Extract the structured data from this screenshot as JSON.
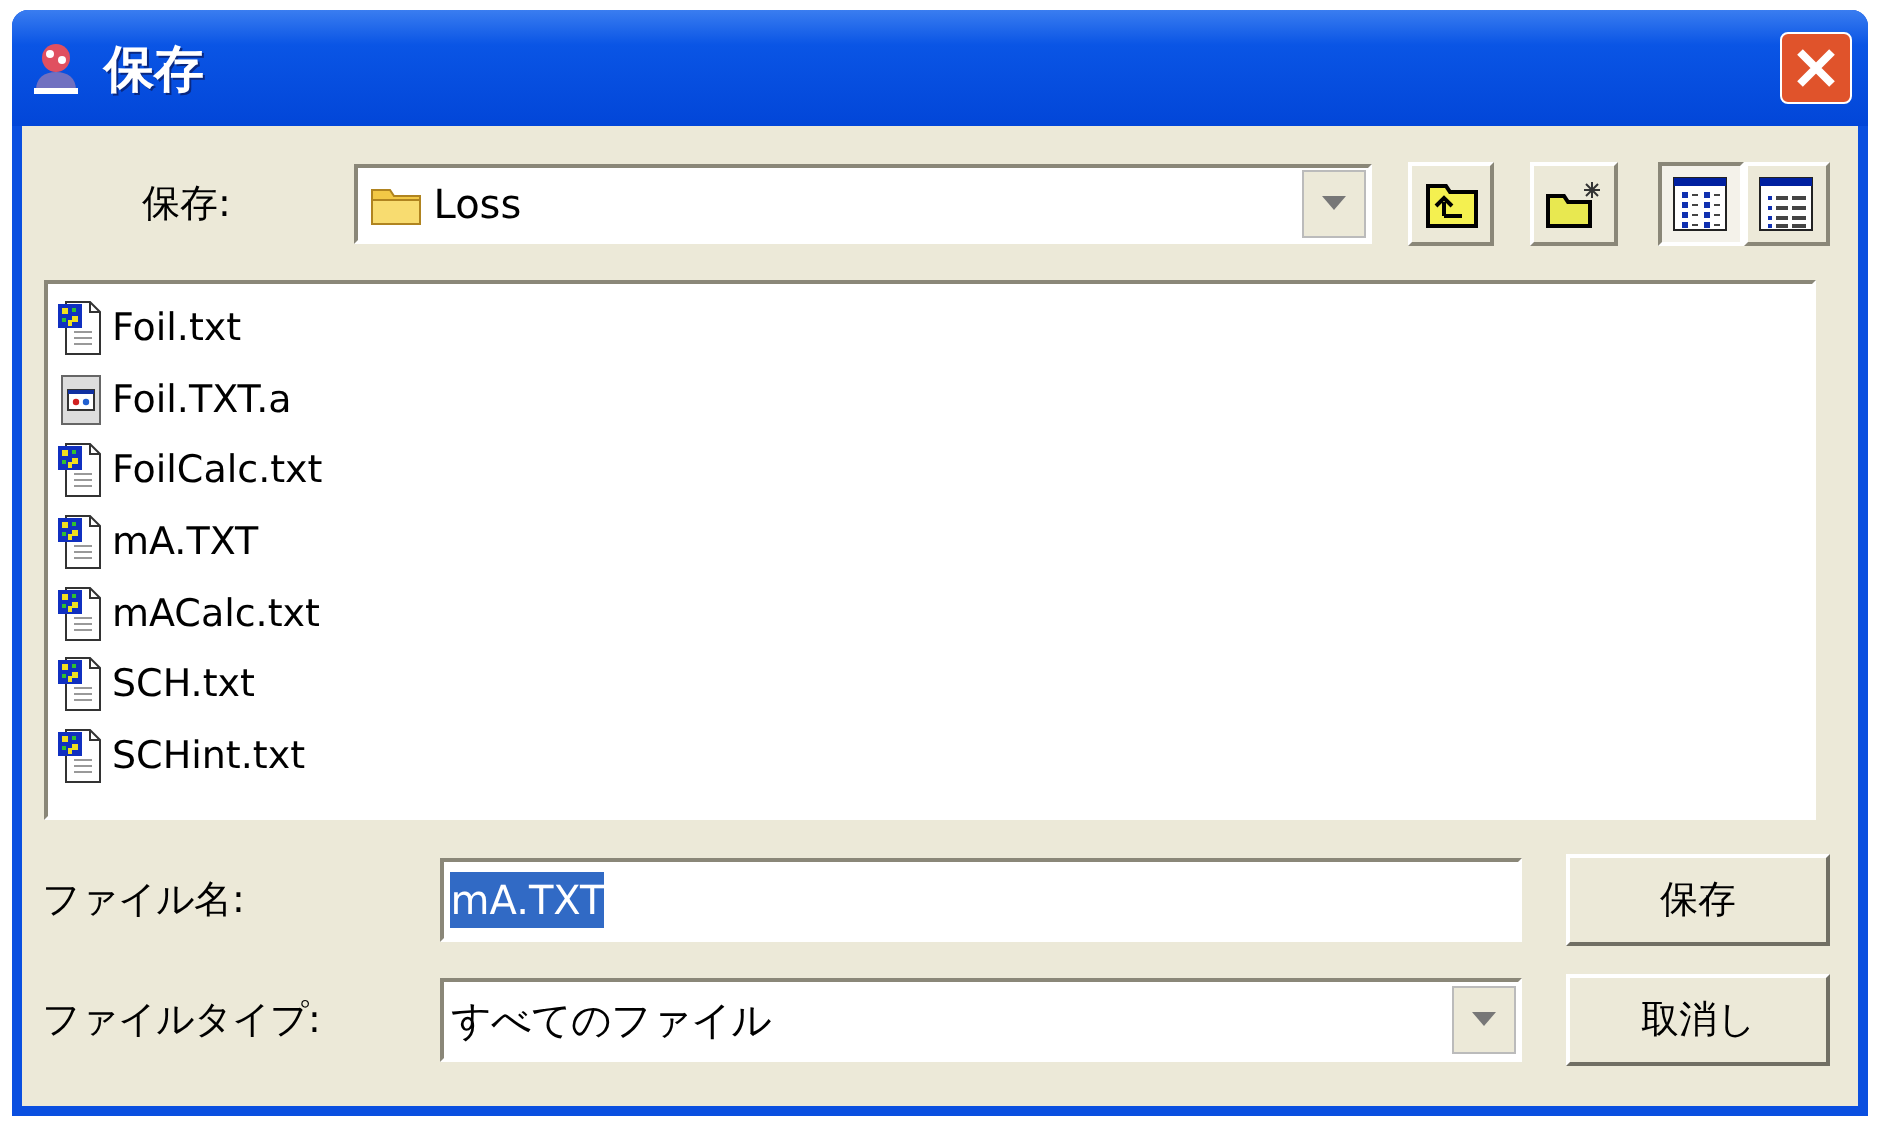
{
  "window": {
    "title": "保存"
  },
  "location": {
    "label": "保存:",
    "value": "Loss"
  },
  "view_buttons": [
    {
      "kind": "list",
      "selected": true
    },
    {
      "kind": "details",
      "selected": false
    }
  ],
  "files": [
    {
      "name": "Foil.txt",
      "kind": "text"
    },
    {
      "name": "Foil.TXT.a",
      "kind": "app"
    },
    {
      "name": "FoilCalc.txt",
      "kind": "text"
    },
    {
      "name": "mA.TXT",
      "kind": "text"
    },
    {
      "name": "mACalc.txt",
      "kind": "text"
    },
    {
      "name": "SCH.txt",
      "kind": "text"
    },
    {
      "name": "SCHint.txt",
      "kind": "text"
    }
  ],
  "file_name": {
    "label": "ファイル名:",
    "value": "mA.TXT",
    "selected": true
  },
  "file_type": {
    "label": "ファイルタイプ:",
    "value": "すべてのファイル"
  },
  "buttons": [
    "保存",
    "取消し"
  ]
}
